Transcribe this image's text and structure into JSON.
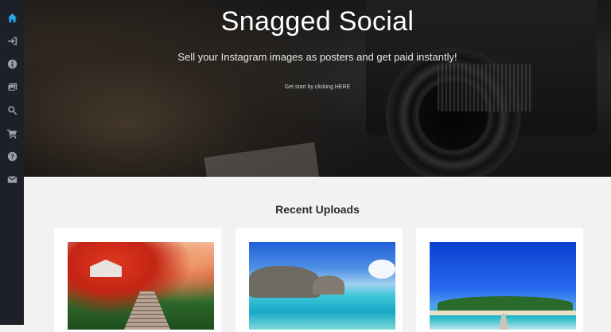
{
  "sidebar": {
    "items": [
      {
        "icon": "home-icon",
        "name": "Home",
        "active": true
      },
      {
        "icon": "sign-in-icon",
        "name": "Sign in",
        "active": false
      },
      {
        "icon": "info-icon",
        "name": "About",
        "active": false
      },
      {
        "icon": "images-icon",
        "name": "Gallery",
        "active": false
      },
      {
        "icon": "search-icon",
        "name": "Search",
        "active": false
      },
      {
        "icon": "cart-icon",
        "name": "Cart",
        "active": false
      },
      {
        "icon": "help-icon",
        "name": "Help",
        "active": false
      },
      {
        "icon": "envelope-icon",
        "name": "Contact",
        "active": false
      }
    ]
  },
  "hero": {
    "title": "Snagged Social",
    "subtitle": "Sell your Instagram images as posters and get paid instantly!",
    "cta": "Get start by clicking HERE"
  },
  "uploads": {
    "title": "Recent Uploads",
    "items": [
      {
        "photo": "autumn garden"
      },
      {
        "photo": "tropical lagoon"
      },
      {
        "photo": "island with pier"
      }
    ]
  },
  "colors": {
    "sidebar_bg": "#1d2027",
    "active_icon": "#2aa7e8",
    "icon": "#9aa0a8",
    "content_bg": "#f2f2f2"
  }
}
